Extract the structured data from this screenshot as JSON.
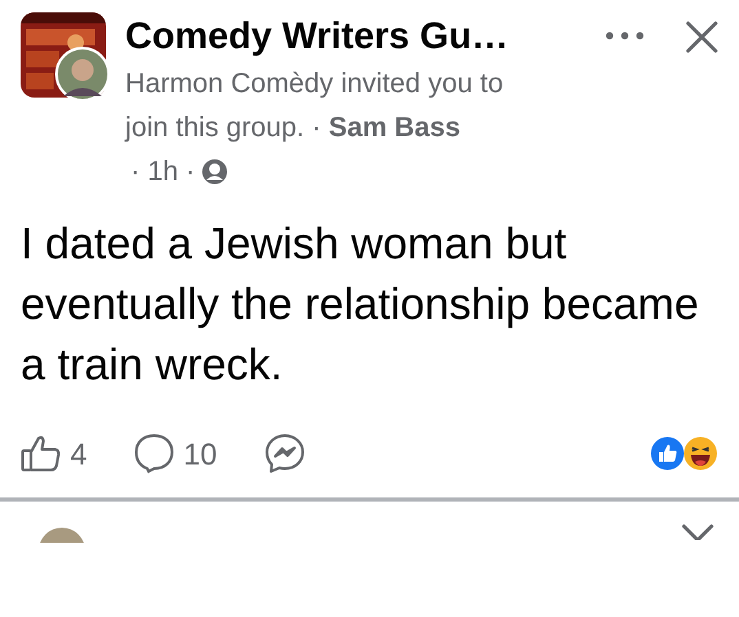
{
  "post_header": {
    "group_name": "Comedy Writers Gu…",
    "byline": "Harmon Comèdy invited you to join this group. · **Sam Bass**",
    "time": "· 1h ·"
  },
  "post": {
    "text": "I dated a Jewish woman but eventually the relationship became a train wreck."
  },
  "actions": [
    {
      "kind": "like",
      "count": "4"
    },
    {
      "kind": "comment",
      "count": "10"
    },
    {
      "kind": "messenger"
    }
  ]
}
